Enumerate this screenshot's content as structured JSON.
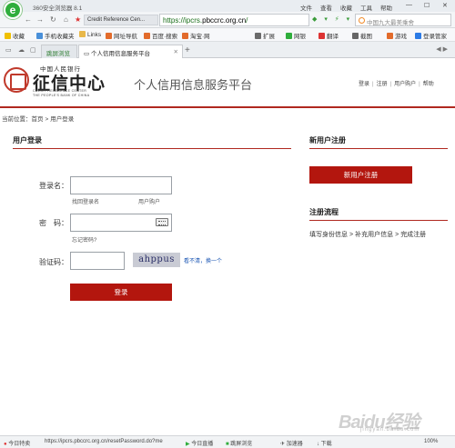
{
  "browser": {
    "app_name": "360安全浏览器 8.1",
    "menu": [
      "文件",
      "查看",
      "收藏",
      "工具",
      "帮助"
    ],
    "tab_chip": "Credit Reference Cen...",
    "url_prefix": "https://ipcrs.",
    "url_domain": "pbccrc.org.cn",
    "url_suffix": "/",
    "search_placeholder": "中国九大最美乘舍",
    "favorites": [
      "收藏",
      "手机收藏夹",
      "Links",
      "网址导航",
      "百度·搜索",
      "淘宝·网"
    ],
    "extensions": [
      "扩展",
      "网银",
      "翻译",
      "截图",
      "游戏",
      "登录管家"
    ],
    "tabs": [
      {
        "label": "跳屏浏览"
      },
      {
        "label": "个人信用信息服务平台"
      }
    ]
  },
  "site": {
    "logo_top": "中国人民银行",
    "logo_main": "征信中心",
    "logo_en1": "CREDIT REFERENCE CENTER",
    "logo_en2": "THE PEOPLE'S BANK OF CHINA",
    "title": "个人信用信息服务平台",
    "toplinks": [
      "登录",
      "注册",
      "用户购户",
      "帮助"
    ]
  },
  "breadcrumb": {
    "label": "当前位置：",
    "items": [
      "首页",
      "用户登录"
    ]
  },
  "login": {
    "title": "用户登录",
    "username_label": "登录名：",
    "find_username": "找回登录名",
    "user_account": "用户购户",
    "password_label": "密　码：",
    "forgot_password": "忘记密码?",
    "captcha_label": "验证码：",
    "captcha_text": "ahppus",
    "captcha_refresh": "看不清，换一个",
    "submit": "登录"
  },
  "register": {
    "title": "新用户注册",
    "button": "新用户注册",
    "flow_title": "注册流程",
    "steps": [
      "填写身份信息",
      "补充用户信息",
      "完成注册"
    ]
  },
  "statusbar": {
    "news": "今日特卖",
    "link_url": "https://ipcrs.pbccrc.org.cn/resetPassword.do?me",
    "live": "今日直播",
    "jump": "跳屏浏览",
    "accelerator": "加速器",
    "download": "下载",
    "zoom": "100%"
  },
  "watermark": {
    "text": "Baidu经验",
    "sub": "jingyan.baidu.com"
  },
  "colors": {
    "accent_red": "#b3160e",
    "divider_red": "#b0281f",
    "browser_green": "#2fae3c"
  }
}
